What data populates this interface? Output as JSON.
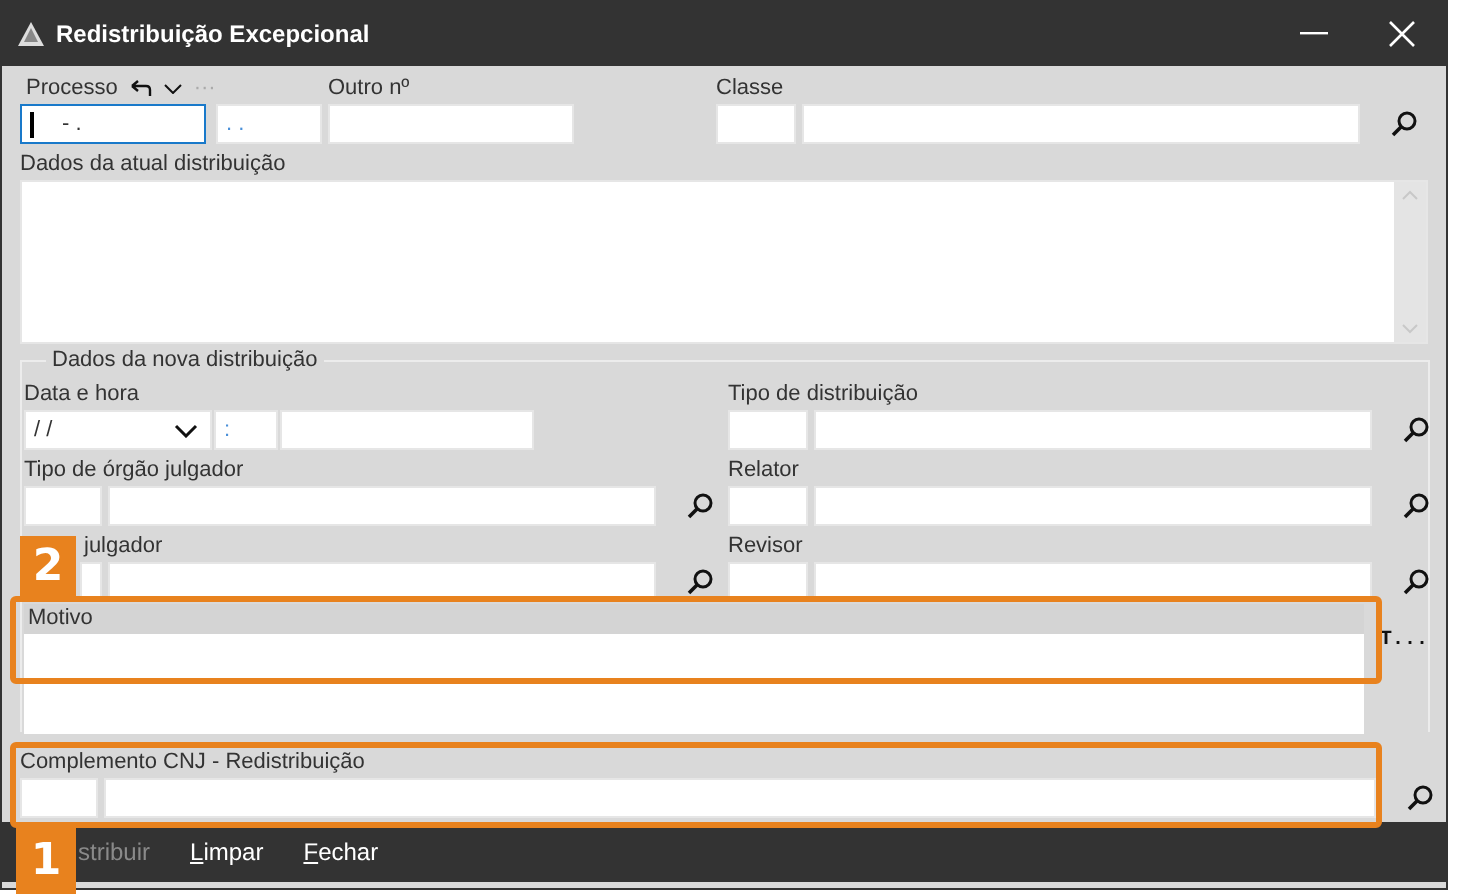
{
  "window": {
    "title": "Redistribuição Excepcional"
  },
  "processo": {
    "label": "Processo",
    "more": "···",
    "value": "- .",
    "suffix_value": ". .",
    "focused": true
  },
  "outro": {
    "label": "Outro nº"
  },
  "classe": {
    "label": "Classe"
  },
  "atual": {
    "label": "Dados da atual distribuição"
  },
  "nova": {
    "legend": "Dados da nova distribuição",
    "data_hora": {
      "label": "Data e hora",
      "date_value": "/ /",
      "time_value": ":"
    },
    "left": [
      {
        "label": "Tipo de órgão julgador"
      },
      {
        "label": "julgador"
      }
    ],
    "right": [
      {
        "label": "Tipo de distribuição"
      },
      {
        "label": "Relator"
      },
      {
        "label": "Revisor"
      }
    ],
    "motivo": {
      "label": "Motivo",
      "side_button": "T..."
    }
  },
  "complemento": {
    "label": "Complemento CNJ - Redistribuição"
  },
  "toolbar": [
    {
      "label": "stribuir",
      "disabled": true,
      "mnemonic": false
    },
    {
      "label": "Limpar",
      "disabled": false,
      "mnemonic": true
    },
    {
      "label": "Fechar",
      "disabled": false,
      "mnemonic": true
    }
  ],
  "callouts": [
    {
      "number": "2"
    },
    {
      "number": "1"
    }
  ]
}
